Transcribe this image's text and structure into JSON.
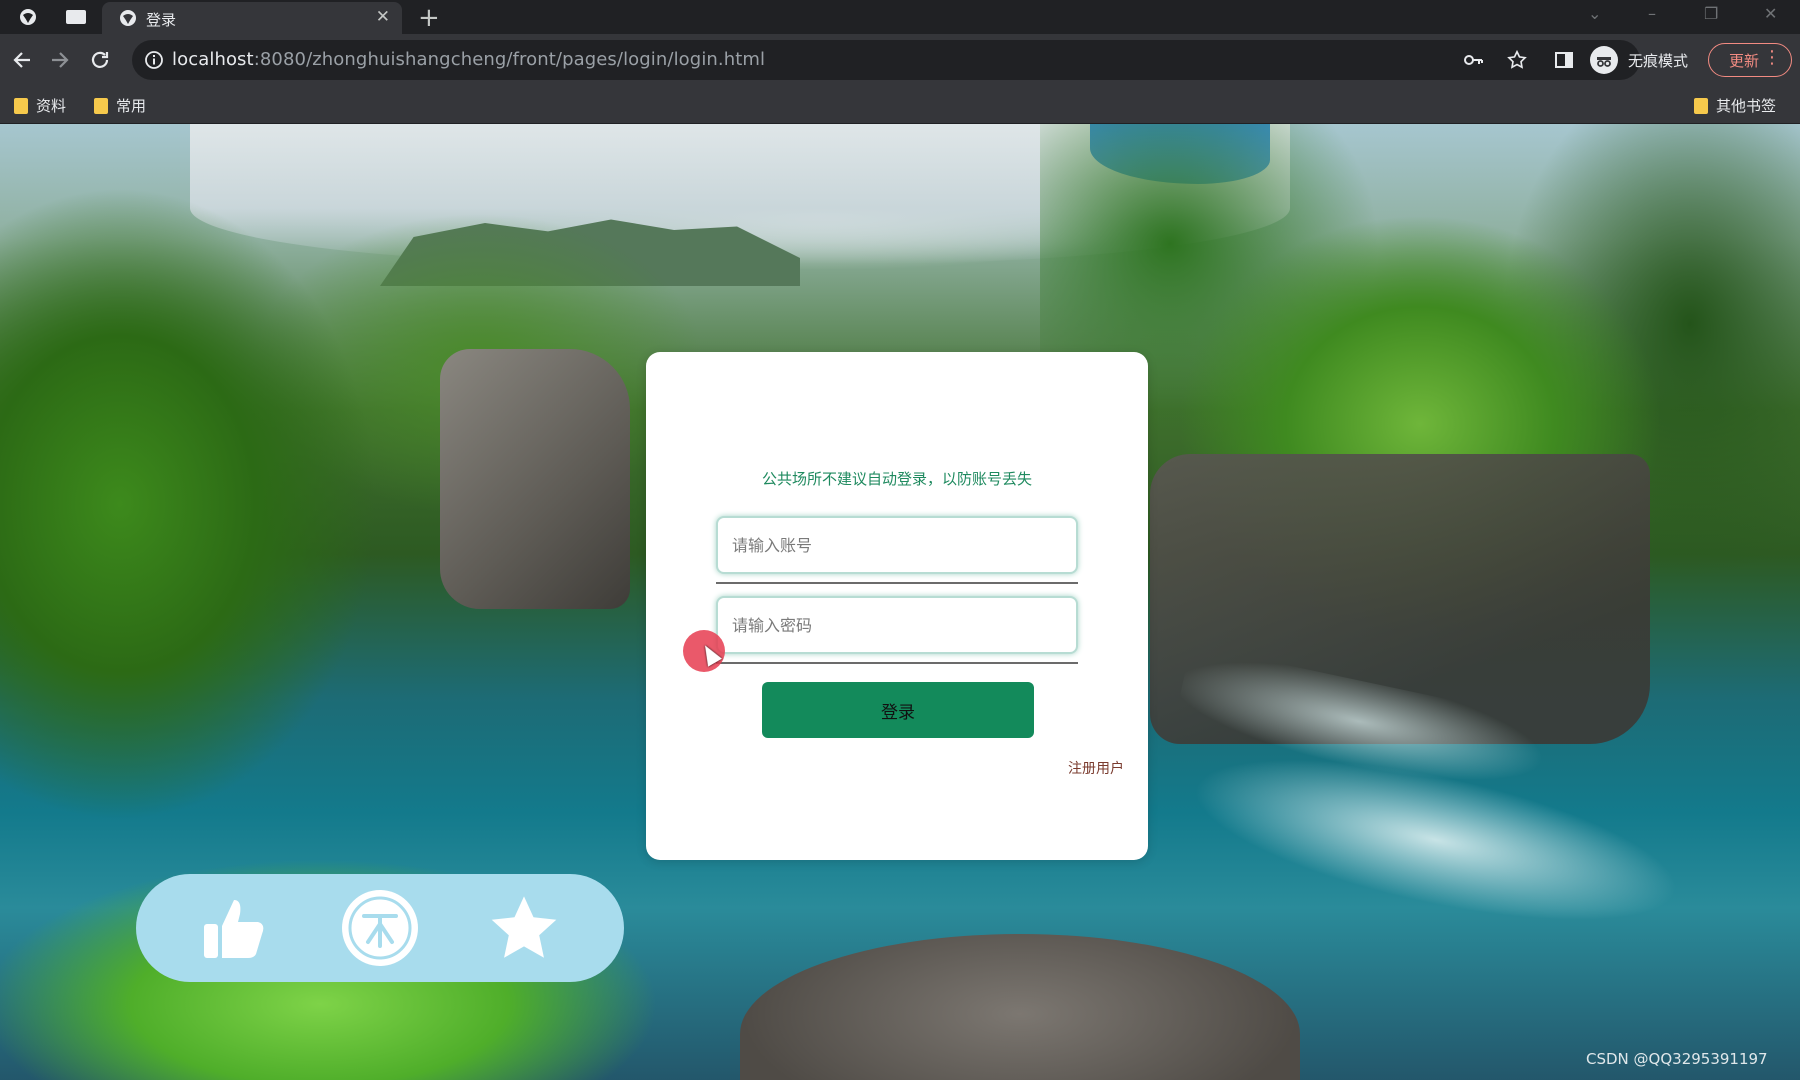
{
  "browser": {
    "tab_title": "登录",
    "url_host": "localhost",
    "url_rest": ":8080/zhonghuishangcheng/front/pages/login/login.html",
    "incognito_label": "无痕模式",
    "update_label": "更新"
  },
  "bookmarks": {
    "items": [
      {
        "label": "资料"
      },
      {
        "label": "常用"
      }
    ],
    "other_label": "其他书签"
  },
  "login": {
    "hint": "公共场所不建议自动登录，以防账号丢失",
    "username_placeholder": "请输入账号",
    "password_placeholder": "请输入密码",
    "login_button": "登录",
    "register_link": "注册用户"
  },
  "action_bar": {
    "icons": [
      "thumbs-up-icon",
      "coin-icon",
      "star-icon"
    ],
    "color": "#a8dced"
  },
  "watermark": "CSDN @QQ3295391197",
  "colors": {
    "accent": "#138a5b",
    "hint_text": "#1f8a5f",
    "chrome_dark": "#202124",
    "chrome_toolbar": "#35363a"
  }
}
